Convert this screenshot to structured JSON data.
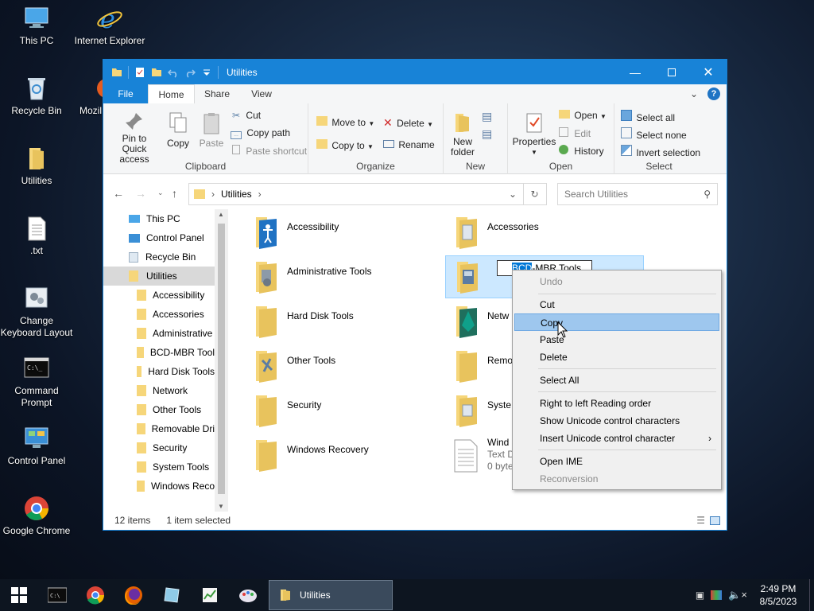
{
  "desktop": {
    "icons": [
      {
        "label": "This PC"
      },
      {
        "label": "Internet Explorer"
      },
      {
        "label": "Recycle Bin"
      },
      {
        "label": "Mozil"
      },
      {
        "label": "Utilities"
      },
      {
        "label": ".txt"
      },
      {
        "label": "Change Keyboard Layout"
      },
      {
        "label": "Command Prompt"
      },
      {
        "label": "Control Panel"
      },
      {
        "label": "Google Chrome"
      }
    ]
  },
  "window": {
    "title": "Utilities",
    "accent": "#1883d7",
    "tabs": {
      "file": "File",
      "home": "Home",
      "share": "Share",
      "view": "View"
    },
    "ribbon": {
      "clipboard": {
        "pin": "Pin to Quick access",
        "copy": "Copy",
        "paste": "Paste",
        "cut": "Cut",
        "copy_path": "Copy path",
        "paste_shortcut": "Paste shortcut",
        "label": "Clipboard"
      },
      "organize": {
        "move_to": "Move to",
        "copy_to": "Copy to",
        "delete": "Delete",
        "rename": "Rename",
        "label": "Organize"
      },
      "new": {
        "new_folder": "New folder",
        "label": "New"
      },
      "open": {
        "properties": "Properties",
        "open": "Open",
        "edit": "Edit",
        "history": "History",
        "label": "Open"
      },
      "select": {
        "select_all": "Select all",
        "select_none": "Select none",
        "invert": "Invert selection",
        "label": "Select"
      }
    },
    "address": {
      "path": "Utilities",
      "search_placeholder": "Search Utilities"
    },
    "nav_pane": [
      {
        "label": "This PC"
      },
      {
        "label": "Control Panel"
      },
      {
        "label": "Recycle Bin"
      },
      {
        "label": "Utilities"
      },
      {
        "label": "Accessibility"
      },
      {
        "label": "Accessories"
      },
      {
        "label": "Administrative"
      },
      {
        "label": "BCD-MBR Tool"
      },
      {
        "label": "Hard Disk Tools"
      },
      {
        "label": "Network"
      },
      {
        "label": "Other Tools"
      },
      {
        "label": "Removable Dri"
      },
      {
        "label": "Security"
      },
      {
        "label": "System Tools"
      },
      {
        "label": "Windows Reco"
      }
    ],
    "items": [
      {
        "label": "Accessibility"
      },
      {
        "label": "Accessories"
      },
      {
        "label": "Administrative Tools"
      },
      {
        "label": "BCD-MBR Tools",
        "rename_value": "BCD-MBR Tools",
        "selected_part": "BCD"
      },
      {
        "label": "Hard Disk Tools"
      },
      {
        "label": "Netw"
      },
      {
        "label": "Other Tools"
      },
      {
        "label": "Remo"
      },
      {
        "label": "Security"
      },
      {
        "label": "Syste"
      },
      {
        "label": "Windows Recovery"
      },
      {
        "label": "Wind",
        "type": "Text D",
        "size": "0 byte"
      }
    ],
    "status": {
      "count": "12 items",
      "selected": "1 item selected"
    }
  },
  "context_menu": {
    "items": [
      {
        "label": "Undo",
        "disabled": true
      },
      {
        "label": "Cut"
      },
      {
        "label": "Copy",
        "highlighted": true
      },
      {
        "label": "Paste"
      },
      {
        "label": "Delete"
      },
      {
        "label": "Select All"
      },
      {
        "label": "Right to left Reading order"
      },
      {
        "label": "Show Unicode control characters"
      },
      {
        "label": "Insert Unicode control character",
        "submenu": true
      },
      {
        "label": "Open IME"
      },
      {
        "label": "Reconversion",
        "disabled": true
      }
    ]
  },
  "taskbar": {
    "active_label": "Utilities",
    "time": "2:49 PM",
    "date": "8/5/2023"
  }
}
